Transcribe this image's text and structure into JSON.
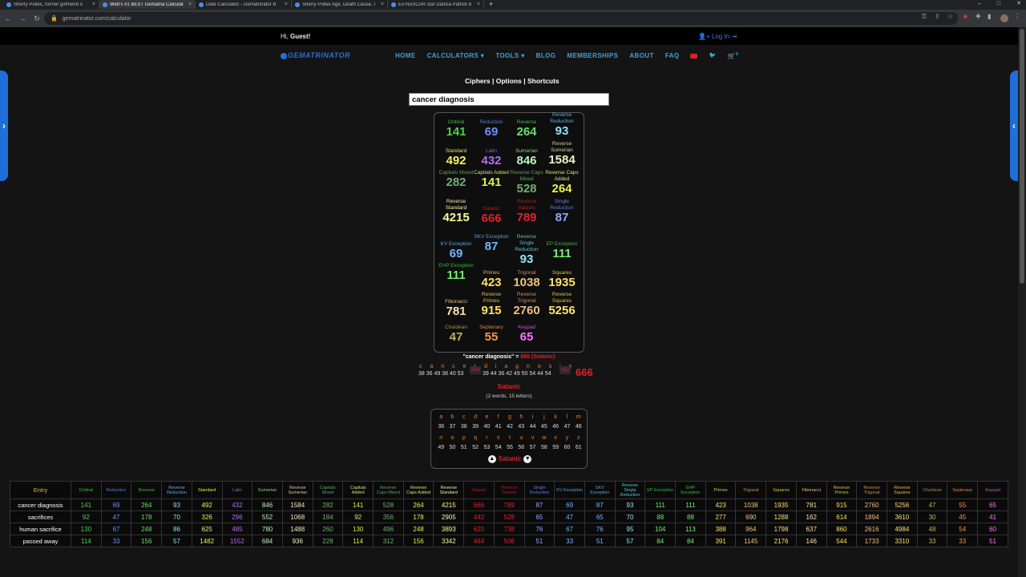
{
  "browser": {
    "tabs": [
      {
        "title": "Sherry Pollex, former girlfriend o"
      },
      {
        "title": "Web's #1 BEST Gematria Calculat"
      },
      {
        "title": "Date Calculator - Gematrinator B"
      },
      {
        "title": "Sherry Pollex Age, Death Cause, I"
      },
      {
        "title": "Ex-NASCAR star Danica Patrick b"
      }
    ],
    "active_tab": 1,
    "url": "gematrinator.com/calculator"
  },
  "header": {
    "greeting_prefix": "Hi, ",
    "greeting_name": "Guest!",
    "login": "Log In",
    "logo": "GEMATRINATOR",
    "nav": [
      "HOME",
      "CALCULATORS ▾",
      "TOOLS ▾",
      "BLOG",
      "MEMBERSHIPS",
      "ABOUT",
      "FAQ"
    ],
    "cart_count": "0"
  },
  "calculator": {
    "links": "Ciphers | Options | Shortcuts",
    "query": "cancer diagnosis",
    "ciphers": [
      {
        "name": "Ordinal",
        "value": "141",
        "name_color": "#3fbf3f",
        "value_color": "#50d050"
      },
      {
        "name": "Reduction",
        "value": "69",
        "name_color": "#5a7be0",
        "value_color": "#6f8fff"
      },
      {
        "name": "Reverse",
        "value": "264",
        "name_color": "#3fbf3f",
        "value_color": "#66e066"
      },
      {
        "name": "Reverse Reduction",
        "value": "93",
        "name_color": "#59b0e0",
        "value_color": "#8fe0ff"
      },
      {
        "name": "Standard",
        "value": "492",
        "name_color": "#e6e64a",
        "value_color": "#f0f060"
      },
      {
        "name": "Latin",
        "value": "432",
        "name_color": "#9a5fd0",
        "value_color": "#b070f0"
      },
      {
        "name": "Sumerian",
        "value": "846",
        "name_color": "#8bcf8b",
        "value_color": "#c0f0c0"
      },
      {
        "name": "Reverse Sumerian",
        "value": "1584",
        "name_color": "#cfcf9f",
        "value_color": "#f0f0c0"
      },
      {
        "name": "Capitals Mixed",
        "value": "282",
        "name_color": "#5fa05f",
        "value_color": "#70b070"
      },
      {
        "name": "Capitals Added",
        "value": "141",
        "name_color": "#d0e070",
        "value_color": "#d8f050"
      },
      {
        "name": "Reverse Caps Mixed",
        "value": "528",
        "name_color": "#5fa05f",
        "value_color": "#70b070"
      },
      {
        "name": "Reverse Caps Added",
        "value": "264",
        "name_color": "#e0e070",
        "value_color": "#e8f050"
      },
      {
        "name": "Reverse Standard",
        "value": "4215",
        "name_color": "#f0f0a0",
        "value_color": "#fbfb9a"
      },
      {
        "name": "Satanic",
        "value": "666",
        "name_color": "#c01818",
        "value_color": "#e0202a"
      },
      {
        "name": "Reverse Satanic",
        "value": "789",
        "name_color": "#c01818",
        "value_color": "#e0202a"
      },
      {
        "name": "Single Reduction",
        "value": "87",
        "name_color": "#5a7be0",
        "value_color": "#8fa8ff"
      },
      {
        "name": "KV Exception",
        "value": "69",
        "name_color": "#5aa0e0",
        "value_color": "#70b8ff"
      },
      {
        "name": "SKV Exception",
        "value": "87",
        "name_color": "#5aa0e0",
        "value_color": "#70b8ff"
      },
      {
        "name": "Reverse Single Reduction",
        "value": "93",
        "name_color": "#5ac0d0",
        "value_color": "#90e8f0"
      },
      {
        "name": "EP Exception",
        "value": "111",
        "name_color": "#40b040",
        "value_color": "#70f070"
      },
      {
        "name": "EHP Exception",
        "value": "111",
        "name_color": "#40b040",
        "value_color": "#70f070"
      },
      {
        "name": "Primes",
        "value": "423",
        "name_color": "#e0c040",
        "value_color": "#ffe060"
      },
      {
        "name": "Trigonal",
        "value": "1038",
        "name_color": "#d09050",
        "value_color": "#f0c080"
      },
      {
        "name": "Squares",
        "value": "1935",
        "name_color": "#e0c040",
        "value_color": "#ffe070"
      },
      {
        "name": "Fibonacci",
        "value": "781",
        "name_color": "#e0c080",
        "value_color": "#ffe0b0"
      },
      {
        "name": "Reverse Primes",
        "value": "915",
        "name_color": "#e0c040",
        "value_color": "#ffe060"
      },
      {
        "name": "Reverse Trigonal",
        "value": "2760",
        "name_color": "#d09050",
        "value_color": "#f0c080"
      },
      {
        "name": "Reverse Squares",
        "value": "5256",
        "name_color": "#e0c040",
        "value_color": "#ffe070"
      },
      {
        "name": "Chaldean",
        "value": "47",
        "name_color": "#a09050",
        "value_color": "#c0b060"
      },
      {
        "name": "Septenary",
        "value": "55",
        "name_color": "#e08040",
        "value_color": "#ff9050"
      },
      {
        "name": "Keypad",
        "value": "65",
        "name_color": "#d050d0",
        "value_color": "#ff70ff"
      }
    ],
    "result_text": "\"cancer diagnosis\" = ",
    "result_value": "666 (Satanic)",
    "breakdown": {
      "word1_letters": "c a n c e r",
      "word1_nums": "38 36 49 38 40 53",
      "word1_total": "254",
      "word2_letters": "d i a g n o s i s",
      "word2_nums": "39 44 36 42 49 50 54 44 54",
      "word2_total": "412",
      "total": "666"
    },
    "cipher_label": "Satanic",
    "word_count": "(2 words, 15 letters)",
    "alphabet": {
      "letters1": [
        "a",
        "b",
        "c",
        "d",
        "e",
        "f",
        "g",
        "h",
        "i",
        "j",
        "k",
        "l",
        "m"
      ],
      "nums1": [
        "36",
        "37",
        "38",
        "39",
        "40",
        "41",
        "42",
        "43",
        "44",
        "45",
        "46",
        "47",
        "48"
      ],
      "letters2": [
        "n",
        "o",
        "p",
        "q",
        "r",
        "s",
        "t",
        "u",
        "v",
        "w",
        "x",
        "y",
        "z"
      ],
      "nums2": [
        "49",
        "50",
        "51",
        "52",
        "53",
        "54",
        "55",
        "56",
        "57",
        "58",
        "59",
        "60",
        "61"
      ],
      "cipher": "Satanic"
    }
  },
  "table": {
    "entry_header": "Entry",
    "headers": [
      "Ordinal",
      "Reduction",
      "Reverse",
      "Reverse Reduction",
      "Standard",
      "Latin",
      "Sumerian",
      "Reverse Sumerian",
      "Capitals Mixed",
      "Capitals Added",
      "Reverse Caps Mixed",
      "Reverse Caps Added",
      "Reverse Standard",
      "Satanic",
      "Reverse Satanic",
      "Single Reduction",
      "KV Exception",
      "SKV Exception",
      "Reverse Single Reduction",
      "EP Exception",
      "EHP Exception",
      "Primes",
      "Trigonal",
      "Squares",
      "Fibonacci",
      "Reverse Primes",
      "Reverse Trigonal",
      "Reverse Squares",
      "Chaldean",
      "Septenary",
      "Keypad"
    ],
    "rows": [
      {
        "entry": "cancer diagnosis",
        "values": [
          "141",
          "69",
          "264",
          "93",
          "492",
          "432",
          "846",
          "1584",
          "282",
          "141",
          "528",
          "264",
          "4215",
          "666",
          "789",
          "87",
          "69",
          "87",
          "93",
          "111",
          "111",
          "423",
          "1038",
          "1935",
          "781",
          "915",
          "2760",
          "5256",
          "47",
          "55",
          "65"
        ]
      },
      {
        "entry": "sacrifices",
        "values": [
          "92",
          "47",
          "178",
          "70",
          "326",
          "296",
          "552",
          "1068",
          "184",
          "92",
          "356",
          "178",
          "2905",
          "442",
          "528",
          "65",
          "47",
          "65",
          "70",
          "88",
          "88",
          "277",
          "690",
          "1288",
          "162",
          "614",
          "1894",
          "3610",
          "30",
          "45",
          "41"
        ]
      },
      {
        "entry": "human sacrifice",
        "values": [
          "130",
          "67",
          "248",
          "86",
          "625",
          "485",
          "780",
          "1488",
          "260",
          "130",
          "496",
          "248",
          "3893",
          "620",
          "738",
          "76",
          "67",
          "76",
          "95",
          "104",
          "113",
          "388",
          "964",
          "1798",
          "637",
          "860",
          "2616",
          "4984",
          "48",
          "54",
          "60"
        ]
      },
      {
        "entry": "passed away",
        "values": [
          "114",
          "33",
          "156",
          "57",
          "1482",
          "1552",
          "684",
          "936",
          "228",
          "114",
          "312",
          "156",
          "3342",
          "464",
          "506",
          "51",
          "33",
          "51",
          "57",
          "84",
          "84",
          "391",
          "1145",
          "2176",
          "146",
          "544",
          "1733",
          "3310",
          "33",
          "33",
          "51"
        ]
      }
    ]
  }
}
